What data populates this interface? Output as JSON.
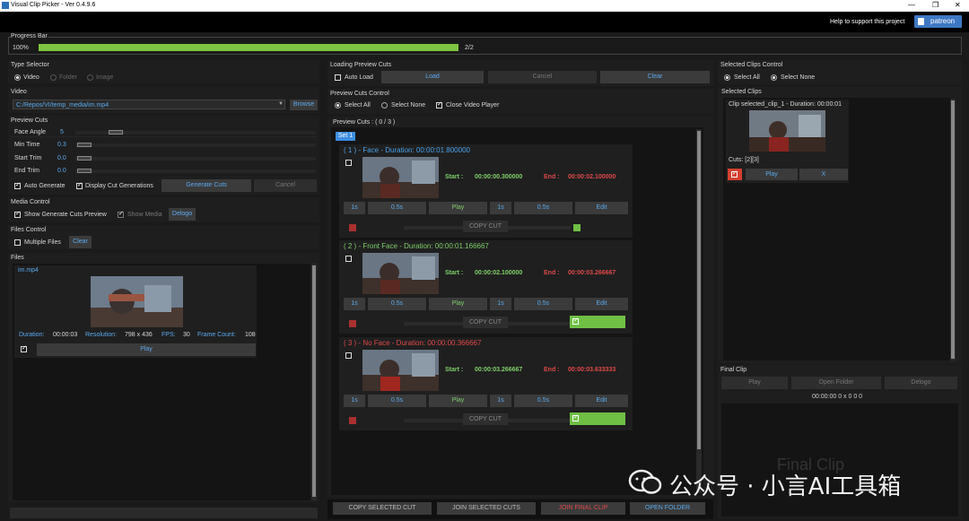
{
  "window": {
    "title": "Visual Clip Picker - Ver 0.4.9.6"
  },
  "header": {
    "support_text": "Help to support this project",
    "patreon_label": "patreon"
  },
  "progress": {
    "title": "Progress Bar",
    "percent_label": "100%",
    "count_label": "2/2",
    "value": 1.0
  },
  "type_selector": {
    "title": "Type Selector",
    "options": [
      "Video",
      "Folder",
      "Image"
    ],
    "selected": "Video"
  },
  "video": {
    "title": "Video",
    "path": "C:/Repos/VI/temp_media/im.mp4",
    "browse_label": "Browse"
  },
  "preview_cuts": {
    "title": "Preview Cuts",
    "face_angle_label": "Face Angle",
    "face_angle_value": "5",
    "min_time_label": "Min Time",
    "min_time_value": "0.3",
    "start_trim_label": "Start Trim",
    "start_trim_value": "0.0",
    "end_trim_label": "End Trim",
    "end_trim_value": "0.0",
    "auto_generate_label": "Auto Generate",
    "display_generations_label": "Display Cut Generations",
    "generate_label": "Generate Cuts",
    "cancel_label": "Cancel"
  },
  "media_control": {
    "title": "Media Control",
    "show_preview_label": "Show Generate Cuts Preview",
    "show_media_label": "Show Media",
    "delogo_label": "Delogo"
  },
  "files_control": {
    "title": "Files Control",
    "multiple_label": "Multiple Files",
    "clear_label": "Clear"
  },
  "files": {
    "title": "Files",
    "item": {
      "name": "im.mp4",
      "duration_label": "Duration:",
      "duration": "00:00:03",
      "resolution_label": "Resolution:",
      "resolution": "798 x 436",
      "fps_label": "FPS:",
      "fps": "30",
      "frame_count_label": "Frame Count:",
      "frame_count": "108",
      "play_label": "Play"
    }
  },
  "loading_preview": {
    "title": "Loading Preview Cuts",
    "auto_load_label": "Auto Load",
    "load_label": "Load",
    "cancel_label": "Cancel",
    "clear_label": "Clear"
  },
  "preview_control": {
    "title": "Preview Cuts Control",
    "select_all_label": "Select All",
    "select_none_label": "Select None",
    "close_player_label": "Close Video Player"
  },
  "preview_list": {
    "title": "Preview Cuts : ( 0 / 3 )",
    "set_label": "Set 1",
    "start_label": "Start :",
    "end_label": "End :",
    "btn_1s": "1s",
    "btn_05s": "0.5s",
    "play_label": "Play",
    "edit_label": "Edit",
    "copy_label": "COPY CUT",
    "cuts": [
      {
        "title": "( 1 ) - Face - Duration: 00:00:01.800000",
        "start": "00:00:00.300000",
        "end": "00:00:02.100000",
        "color": "#4aa0e8"
      },
      {
        "title": "( 2 ) - Front Face - Duration: 00:00:01.166667",
        "start": "00:00:02.100000",
        "end": "00:00:03.266667",
        "color": "#7fd06a"
      },
      {
        "title": "( 3 ) - No Face - Duration: 00:00:00.366667",
        "start": "00:00:03.266667",
        "end": "00:00:03.633333",
        "color": "#e04848"
      }
    ]
  },
  "bottom_bar": {
    "copy_selected": "COPY SELECTED CUT",
    "join_selected": "JOIN SELECTED CUTS",
    "join_final": "JOIN FINAL CLIP",
    "open_folder": "OPEN FOLDER"
  },
  "selected_control": {
    "title": "Selected Clips Control",
    "select_all_label": "Select All",
    "select_none_label": "Select None"
  },
  "selected_clips": {
    "title": "Selected Clips",
    "clip_title": "Clip selected_clip_1 - Duration: 00:00:01",
    "cuts_label": "Cuts: [2][3]",
    "play_label": "Play",
    "remove_label": "X"
  },
  "final_clip": {
    "title": "Final Clip",
    "play_label": "Play",
    "open_folder_label": "Open Folder",
    "delogo_label": "Delogo",
    "info": "00:00:00 0 x 0 0 0"
  },
  "watermark": {
    "text": "公众号 · 小言AI工具箱",
    "faint_text": "Final Clip"
  },
  "colors": {
    "accent_blue": "#5aaaf0",
    "green": "#7fd06a",
    "red": "#e04848",
    "progress": "#7cc441"
  }
}
